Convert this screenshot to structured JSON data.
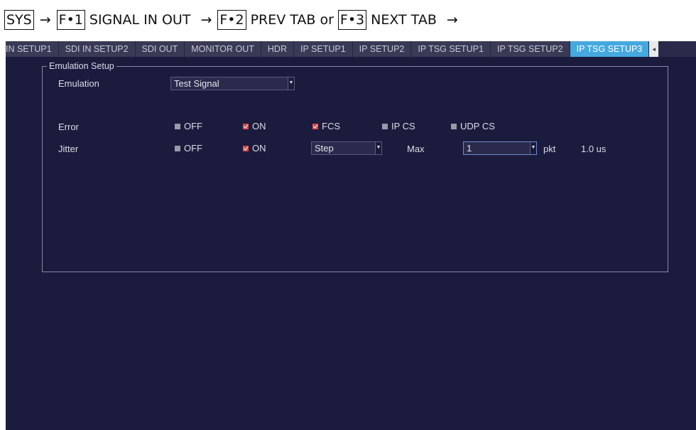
{
  "nav": {
    "sys": "SYS",
    "arrow": "→",
    "f1_key": "F•1",
    "f1_label": "SIGNAL IN OUT",
    "f2_key": "F•2",
    "f2_label": "PREV TAB",
    "or": "or",
    "f3_key": "F•3",
    "f3_label": "NEXT TAB"
  },
  "tabs": [
    {
      "label": "IN SETUP1",
      "active": false
    },
    {
      "label": "SDI IN SETUP2",
      "active": false
    },
    {
      "label": "SDI OUT",
      "active": false
    },
    {
      "label": "MONITOR OUT",
      "active": false
    },
    {
      "label": "HDR",
      "active": false
    },
    {
      "label": "IP SETUP1",
      "active": false
    },
    {
      "label": "IP SETUP2",
      "active": false
    },
    {
      "label": "IP TSG SETUP1",
      "active": false
    },
    {
      "label": "IP TSG SETUP2",
      "active": false
    },
    {
      "label": "IP TSG SETUP3",
      "active": true
    }
  ],
  "tab_scroll_icon": "chevron-left-icon",
  "group": {
    "title": "Emulation Setup",
    "emulation": {
      "label": "Emulation",
      "value": "Test Signal"
    },
    "error": {
      "label": "Error",
      "off": {
        "label": "OFF",
        "checked": false
      },
      "on": {
        "label": "ON",
        "checked": true
      },
      "fcs": {
        "label": "FCS",
        "checked": true
      },
      "ipcs": {
        "label": "IP CS",
        "checked": false
      },
      "udpcs": {
        "label": "UDP CS",
        "checked": false
      }
    },
    "jitter": {
      "label": "Jitter",
      "off": {
        "label": "OFF",
        "checked": false
      },
      "on": {
        "label": "ON",
        "checked": true
      },
      "mode_value": "Step",
      "max_label": "Max",
      "max_value": "1",
      "unit": "pkt",
      "time": "1.0 us"
    }
  },
  "colors": {
    "background": "#1b1b3e",
    "active_tab": "#45a9e0",
    "checked_box": "#d84a4a"
  }
}
